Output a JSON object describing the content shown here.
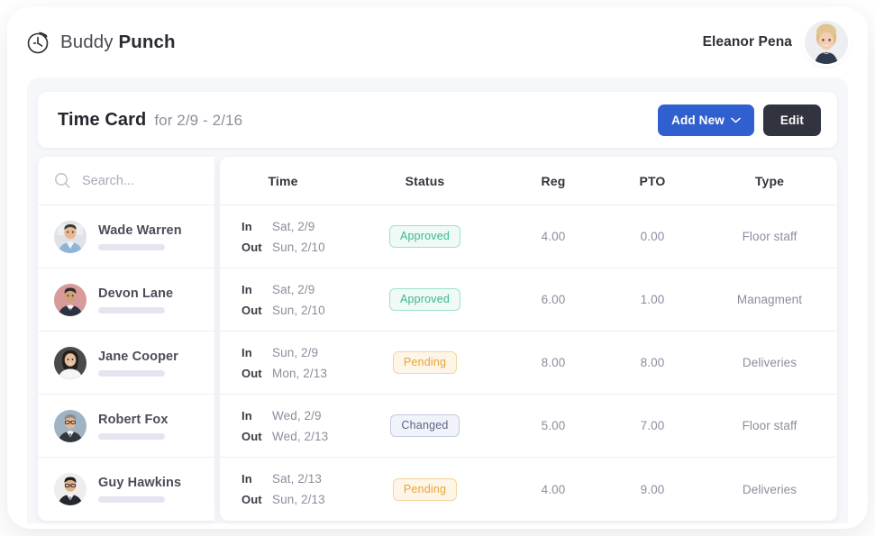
{
  "brand": {
    "logo_icon": "clock-arrow-icon",
    "name_light": "Buddy",
    "name_bold": "Punch"
  },
  "user": {
    "name": "Eleanor Pena",
    "avatar_icon": "user-avatar-photo"
  },
  "card_header": {
    "title": "Time Card",
    "subtitle": "for 2/9 - 2/16",
    "add_new_label": "Add New",
    "add_new_icon": "chevron-down-icon",
    "edit_label": "Edit"
  },
  "search": {
    "icon": "search-icon",
    "placeholder": "Search...",
    "value": ""
  },
  "columns": {
    "time": "Time",
    "status": "Status",
    "reg": "Reg",
    "pto": "PTO",
    "type": "Type"
  },
  "labels": {
    "in": "In",
    "out": "Out"
  },
  "colors": {
    "primary_button": "#3060cf",
    "dark_button": "#31343e",
    "approved": "#3ab795",
    "pending": "#e7a33a",
    "changed": "#5b6683",
    "page_background": "#f6f7fa"
  },
  "rows": [
    {
      "name": "Wade Warren",
      "in_label": "In",
      "in_value": "Sat, 2/9",
      "out_label": "Out",
      "out_value": "Sun, 2/10",
      "status": "Approved",
      "status_kind": "approved",
      "reg": "4.00",
      "pto": "0.00",
      "type": "Floor staff"
    },
    {
      "name": "Devon Lane",
      "in_label": "In",
      "in_value": "Sat, 2/9",
      "out_label": "Out",
      "out_value": "Sun, 2/10",
      "status": "Approved",
      "status_kind": "approved",
      "reg": "6.00",
      "pto": "1.00",
      "type": "Managment"
    },
    {
      "name": "Jane Cooper",
      "in_label": "In",
      "in_value": "Sun, 2/9",
      "out_label": "Out",
      "out_value": "Mon, 2/13",
      "status": "Pending",
      "status_kind": "pending",
      "reg": "8.00",
      "pto": "8.00",
      "type": "Deliveries"
    },
    {
      "name": "Robert Fox",
      "in_label": "In",
      "in_value": "Wed, 2/9",
      "out_label": "Out",
      "out_value": "Wed, 2/13",
      "status": "Changed",
      "status_kind": "changed",
      "reg": "5.00",
      "pto": "7.00",
      "type": "Floor staff"
    },
    {
      "name": "Guy Hawkins",
      "in_label": "In",
      "in_value": "Sat, 2/13",
      "out_label": "Out",
      "out_value": "Sun, 2/13",
      "status": "Pending",
      "status_kind": "pending",
      "reg": "4.00",
      "pto": "9.00",
      "type": "Deliveries"
    }
  ]
}
